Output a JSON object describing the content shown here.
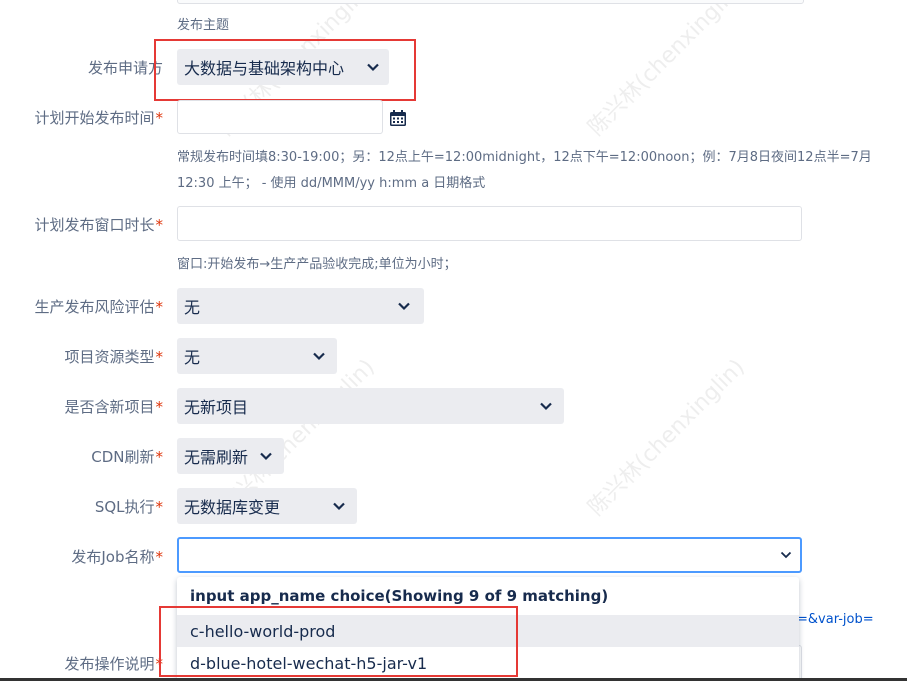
{
  "form": {
    "topic_help": "发布主题",
    "applicant": {
      "label": "发布申请方",
      "value": "大数据与基础架构中心"
    },
    "plan_start": {
      "label": "计划开始发布时间",
      "required_mark": "*",
      "value": "",
      "help_line1": "常规发布时间填8:30-19:00；另：12点上午=12:00midnight，12点下午=12:00noon；例：7月8日夜间12点半=7月",
      "help_line2": "12:30 上午； - 使用 dd/MMM/yy h:mm a 日期格式",
      "calendar_icon": "calendar-icon"
    },
    "window": {
      "label": "计划发布窗口时长",
      "required_mark": "*",
      "value": "",
      "help": "窗口:开始发布→生产产品验收完成;单位为小时；"
    },
    "risk": {
      "label": "生产发布风险评估",
      "required_mark": "*",
      "value": "无"
    },
    "resource_type": {
      "label": "项目资源类型",
      "required_mark": "*",
      "value": "无"
    },
    "new_project": {
      "label": "是否含新项目",
      "required_mark": "*",
      "value": "无新项目"
    },
    "cdn": {
      "label": "CDN刷新",
      "required_mark": "*",
      "value": "无需刷新"
    },
    "sql": {
      "label": "SQL执行",
      "required_mark": "*",
      "value": "无数据库变更"
    },
    "job": {
      "label": "发布Job名称",
      "required_mark": "*",
      "value": ""
    },
    "ops_note": {
      "label": "发布操作说明",
      "required_mark": "*"
    },
    "side_link_text": "=&var-job="
  },
  "dropdown": {
    "header": "input app_name choice(Showing 9 of 9 matching)",
    "options": [
      "c-hello-world-prod",
      "d-blue-hotel-wechat-h5-jar-v1"
    ]
  },
  "watermark_text": "陈兴林(chenxinglin)",
  "colors": {
    "highlight": "#e53935",
    "select_bg": "#ebecf0",
    "required": "#de350b",
    "focus": "#4c9aff"
  }
}
